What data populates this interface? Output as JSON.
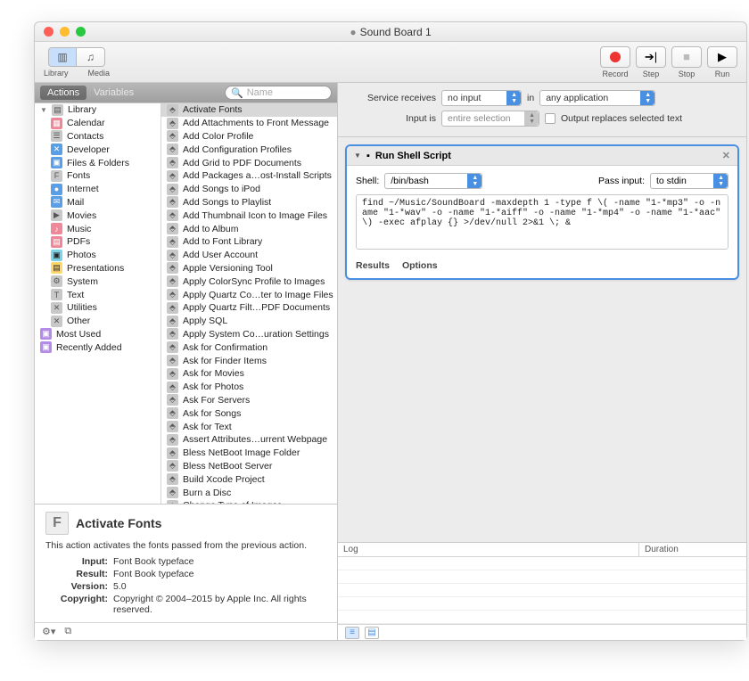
{
  "window": {
    "title": "Sound Board 1",
    "dirty_indicator": "●"
  },
  "toolbar": {
    "library_label": "Library",
    "media_label": "Media",
    "record": "Record",
    "step": "Step",
    "stop": "Stop",
    "run": "Run"
  },
  "tabs": {
    "actions": "Actions",
    "variables": "Variables",
    "search_placeholder": "Name"
  },
  "categories": [
    {
      "label": "Library",
      "top": true,
      "icon": "i-gray",
      "glyph": "▤"
    },
    {
      "label": "Calendar",
      "icon": "i-red",
      "glyph": "▦"
    },
    {
      "label": "Contacts",
      "icon": "i-gray",
      "glyph": "☰"
    },
    {
      "label": "Developer",
      "icon": "i-blue",
      "glyph": "✕"
    },
    {
      "label": "Files & Folders",
      "icon": "i-blue",
      "glyph": "▣"
    },
    {
      "label": "Fonts",
      "icon": "i-gray",
      "glyph": "F"
    },
    {
      "label": "Internet",
      "icon": "i-blue",
      "glyph": "●"
    },
    {
      "label": "Mail",
      "icon": "i-blue",
      "glyph": "✉"
    },
    {
      "label": "Movies",
      "icon": "i-gray",
      "glyph": "▶"
    },
    {
      "label": "Music",
      "icon": "i-red",
      "glyph": "♪"
    },
    {
      "label": "PDFs",
      "icon": "i-red",
      "glyph": "▤"
    },
    {
      "label": "Photos",
      "icon": "i-cyan",
      "glyph": "▣"
    },
    {
      "label": "Presentations",
      "icon": "i-yel",
      "glyph": "▤"
    },
    {
      "label": "System",
      "icon": "i-gray",
      "glyph": "⚙"
    },
    {
      "label": "Text",
      "icon": "i-gray",
      "glyph": "T"
    },
    {
      "label": "Utilities",
      "icon": "i-gray",
      "glyph": "✕"
    },
    {
      "label": "Other",
      "icon": "i-gray",
      "glyph": "✕"
    },
    {
      "label": "Most Used",
      "top": true,
      "icon": "i-purple",
      "glyph": "▣"
    },
    {
      "label": "Recently Added",
      "top": true,
      "icon": "i-purple",
      "glyph": "▣"
    }
  ],
  "actions": [
    {
      "label": "Activate Fonts",
      "selected": true
    },
    {
      "label": "Add Attachments to Front Message"
    },
    {
      "label": "Add Color Profile"
    },
    {
      "label": "Add Configuration Profiles"
    },
    {
      "label": "Add Grid to PDF Documents"
    },
    {
      "label": "Add Packages a…ost-Install Scripts"
    },
    {
      "label": "Add Songs to iPod"
    },
    {
      "label": "Add Songs to Playlist"
    },
    {
      "label": "Add Thumbnail Icon to Image Files"
    },
    {
      "label": "Add to Album"
    },
    {
      "label": "Add to Font Library"
    },
    {
      "label": "Add User Account"
    },
    {
      "label": "Apple Versioning Tool"
    },
    {
      "label": "Apply ColorSync Profile to Images"
    },
    {
      "label": "Apply Quartz Co…ter to Image Files"
    },
    {
      "label": "Apply Quartz Filt…PDF Documents"
    },
    {
      "label": "Apply SQL"
    },
    {
      "label": "Apply System Co…uration Settings"
    },
    {
      "label": "Ask for Confirmation"
    },
    {
      "label": "Ask for Finder Items"
    },
    {
      "label": "Ask for Movies"
    },
    {
      "label": "Ask for Photos"
    },
    {
      "label": "Ask For Servers"
    },
    {
      "label": "Ask for Songs"
    },
    {
      "label": "Ask for Text"
    },
    {
      "label": "Assert Attributes…urrent Webpage"
    },
    {
      "label": "Bless NetBoot Image Folder"
    },
    {
      "label": "Bless NetBoot Server"
    },
    {
      "label": "Build Xcode Project"
    },
    {
      "label": "Burn a Disc"
    },
    {
      "label": "Change Type of Images"
    }
  ],
  "info": {
    "title": "Activate Fonts",
    "desc": "This action activates the fonts passed from the previous action.",
    "input_k": "Input:",
    "input_v": "Font Book typeface",
    "result_k": "Result:",
    "result_v": "Font Book typeface",
    "version_k": "Version:",
    "version_v": "5.0",
    "copyright_k": "Copyright:",
    "copyright_v": "Copyright © 2004–2015 by Apple Inc. All rights reserved."
  },
  "service": {
    "receives_lbl": "Service receives",
    "receives_val": "no input",
    "in_lbl": "in",
    "app_val": "any application",
    "input_is_lbl": "Input is",
    "input_is_val": "entire selection",
    "replaces": "Output replaces selected text"
  },
  "step": {
    "title": "Run Shell Script",
    "shell_lbl": "Shell:",
    "shell_val": "/bin/bash",
    "pass_lbl": "Pass input:",
    "pass_val": "to stdin",
    "code": "find ~/Music/SoundBoard -maxdepth 1 -type f \\( -name \"1-*mp3\" -o -name \"1-*wav\" -o -name \"1-*aiff\" -o -name \"1-*mp4\" -o -name \"1-*aac\" \\) -exec afplay {} >/dev/null 2>&1 \\; &",
    "results": "Results",
    "options": "Options"
  },
  "log": {
    "col1": "Log",
    "col2": "Duration"
  }
}
